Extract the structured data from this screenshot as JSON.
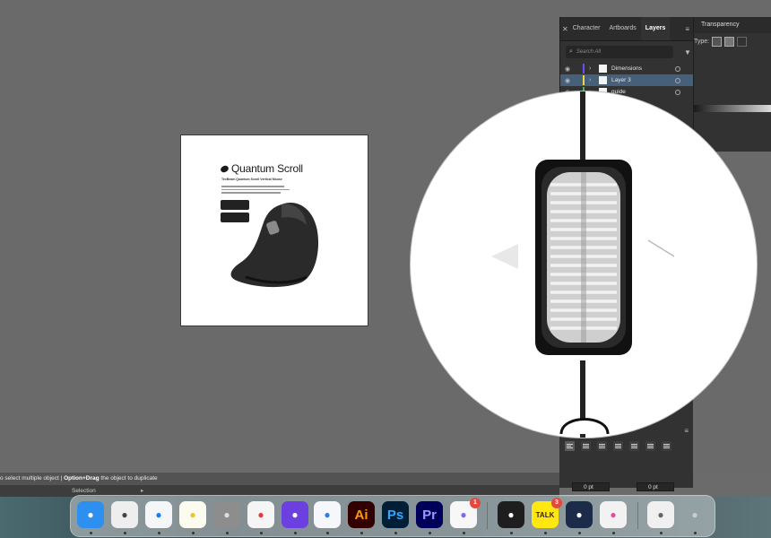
{
  "artboard": {
    "product_name": "Quantum Scroll",
    "product_subtitle": "TecBeam Quantum Scroll Vertical Mouse"
  },
  "panel": {
    "tabs": [
      "Character",
      "Artboards",
      "Layers"
    ],
    "active_tab": "Layers",
    "search_placeholder": "Search All",
    "layers": [
      {
        "name": "Dimensions",
        "color": "#6a4cff",
        "selected": false
      },
      {
        "name": "Layer 3",
        "color": "#e8d84a",
        "selected": true
      },
      {
        "name": "guide",
        "color": "#3fbf4a",
        "selected": false
      }
    ]
  },
  "transparency": {
    "title": "Transparency",
    "type_label": "Type:"
  },
  "paragraph": {
    "spacing_before": "0 pt",
    "spacing_after": "0 pt"
  },
  "status": {
    "hint_prefix": "o select multiple object  |  ",
    "hint_bold": "Option+Drag",
    "hint_suffix": " the object to duplicate",
    "tool": "Selection"
  },
  "dock": {
    "apps": [
      {
        "name": "Finder",
        "label": "",
        "color": "#2d8ff0",
        "fg": "#fff"
      },
      {
        "name": "Launchpad",
        "label": "",
        "color": "#eeeeee",
        "fg": "#444"
      },
      {
        "name": "Safari",
        "label": "",
        "color": "#f4f6f8",
        "fg": "#1e7bf0"
      },
      {
        "name": "Notes",
        "label": "",
        "color": "#fbfbf0",
        "fg": "#e9c43a"
      },
      {
        "name": "System Settings",
        "label": "",
        "color": "#8d8d8d",
        "fg": "#ddd"
      },
      {
        "name": "Chrome",
        "label": "",
        "color": "#f5f5f5",
        "fg": "#e53935"
      },
      {
        "name": "Arc",
        "label": "",
        "color": "#6b3fe0",
        "fg": "#fff"
      },
      {
        "name": "Mail",
        "label": "",
        "color": "#f5f7fa",
        "fg": "#2f7de1"
      },
      {
        "name": "Illustrator",
        "label": "Ai",
        "color": "#330000",
        "fg": "#ff9a00"
      },
      {
        "name": "Photoshop",
        "label": "Ps",
        "color": "#001e36",
        "fg": "#31a8ff"
      },
      {
        "name": "Premiere Pro",
        "label": "Pr",
        "color": "#00005b",
        "fg": "#9999ff"
      },
      {
        "name": "ClickUp",
        "label": "",
        "color": "#f7f7f7",
        "fg": "#7b68ee",
        "badge": "1"
      },
      {
        "name": "Figma",
        "label": "",
        "color": "#1e1e1e",
        "fg": "#fff"
      },
      {
        "name": "KakaoTalk",
        "label": "TALK",
        "color": "#ffe812",
        "fg": "#3a1d1d",
        "badge": "3"
      },
      {
        "name": "Linear",
        "label": "",
        "color": "#1c2b4a",
        "fg": "#fff"
      },
      {
        "name": "Pinwheel",
        "label": "",
        "color": "#f2f2f2",
        "fg": "#e04f9b"
      },
      {
        "name": "Preview",
        "label": "",
        "color": "#f0f0f0",
        "fg": "#666"
      },
      {
        "name": "Trash",
        "label": "",
        "color": "transparent",
        "fg": "#ccc"
      }
    ]
  }
}
